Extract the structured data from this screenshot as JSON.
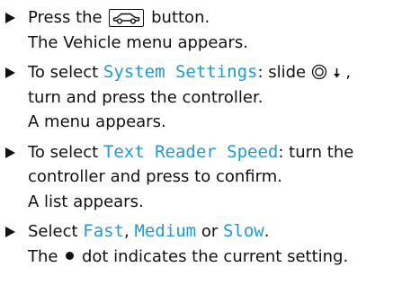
{
  "steps": [
    {
      "parts": {
        "a": "Press the",
        "b": "button.",
        "result": "The Vehicle menu appears."
      }
    },
    {
      "parts": {
        "a": "To select ",
        "ui": "System Settings",
        "b": ": slide",
        "c": ",",
        "d": "turn and press the controller.",
        "result": "A menu appears."
      }
    },
    {
      "parts": {
        "a": "To select ",
        "ui": "Text Reader Speed",
        "b": ": turn the",
        "c": "controller and press to confirm.",
        "result": "A list appears."
      }
    },
    {
      "parts": {
        "a": "Select ",
        "opt1": "Fast",
        "sep1": ", ",
        "opt2": "Medium",
        "sep2": " or ",
        "opt3": "Slow",
        "end": ".",
        "r1": "The",
        "r2": "dot indicates the current setting."
      }
    }
  ],
  "icons": {
    "vehicle_button": "car-icon",
    "controller": "controller-icon",
    "slide_down": "down-arrow-icon",
    "selected_dot": "filled-dot-icon"
  },
  "colors": {
    "ui_text": "#1e9bd7",
    "body_text": "#111111"
  }
}
